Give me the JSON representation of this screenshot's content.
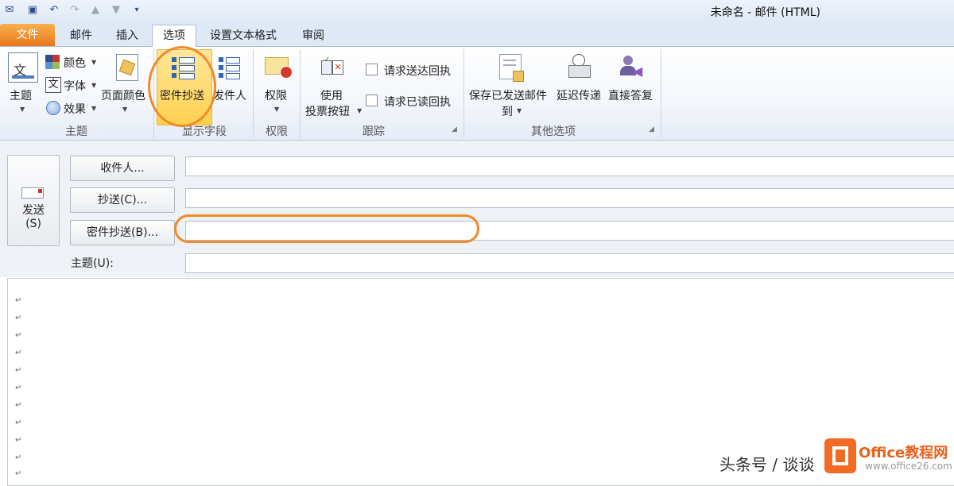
{
  "window": {
    "title": "未命名 - 邮件 (HTML)"
  },
  "tabs": {
    "file": "文件",
    "mail": "邮件",
    "insert": "插入",
    "options": "选项",
    "format_text": "设置文本格式",
    "review": "审阅"
  },
  "ribbon": {
    "theme_group": {
      "theme": "主题",
      "colors": "颜色",
      "fonts": "字体",
      "effects": "效果",
      "page_color": "页面颜色",
      "label": "主题"
    },
    "show_fields_group": {
      "bcc": "密件抄送",
      "from": "发件人",
      "label": "显示字段"
    },
    "permission_group": {
      "permission": "权限",
      "label": "权限"
    },
    "tracking_group": {
      "use_voting_line1": "使用",
      "use_voting_line2": "投票按钮",
      "request_delivery": "请求送达回执",
      "request_read": "请求已读回执",
      "label": "跟踪"
    },
    "more_options_group": {
      "save_sent_line1": "保存已发送邮件",
      "save_sent_line2": "到",
      "delay_delivery": "延迟传递",
      "direct_replies": "直接答复",
      "label": "其他选项"
    }
  },
  "compose": {
    "send_line1": "发送",
    "send_line2": "(S)",
    "to_button": "收件人...",
    "cc_button": "抄送(C)...",
    "bcc_button": "密件抄送(B)...",
    "subject_label": "主题(U):",
    "to_value": "",
    "cc_value": "",
    "bcc_value": "",
    "subject_value": "",
    "paragraph_mark": "↵"
  },
  "watermark": {
    "text": "头条号 / 谈谈",
    "site": "Office教程网",
    "url": "www.office26.com"
  },
  "colors": {
    "accent_file_tab": "#e8781c",
    "highlight": "#ffd04f",
    "annotation": "#f08a2a"
  }
}
